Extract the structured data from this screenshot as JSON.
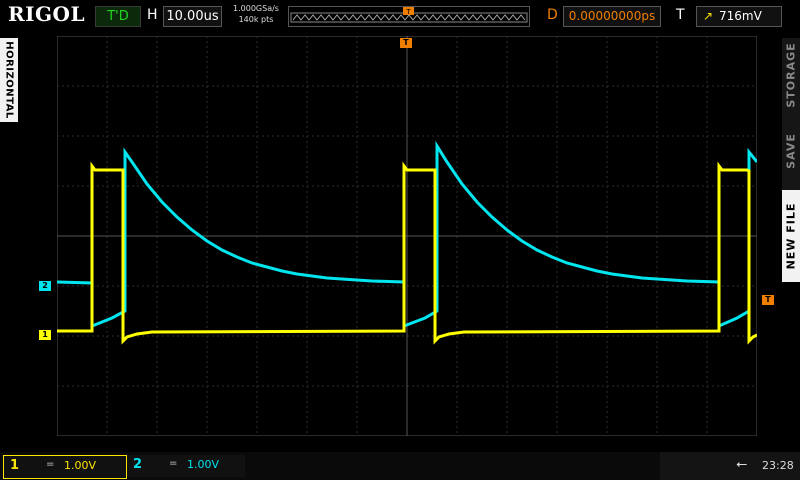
{
  "brand": "RIGOL",
  "run_status": "T'D",
  "horizontal": {
    "label": "H",
    "timebase": "10.00us"
  },
  "acquisition": {
    "sample_rate": "1.000GSa/s",
    "memory_depth": "140k pts"
  },
  "delay": {
    "label": "D",
    "value": "0.00000000ps"
  },
  "trigger": {
    "label": "T",
    "icon": "rising-edge-icon",
    "level": "716mV"
  },
  "left_menu": {
    "label": "HORIZONTAL"
  },
  "right_menu": {
    "items": [
      "STORAGE",
      "SAVE",
      "NEW FILE"
    ]
  },
  "channels": [
    {
      "number": "1",
      "coupling": "=",
      "scale": "1.00V",
      "color": "#ffff00"
    },
    {
      "number": "2",
      "coupling": "=",
      "scale": "1.00V",
      "color": "#00e5ee"
    }
  ],
  "markers": {
    "ch1": "1",
    "ch2": "2",
    "trigger": "T"
  },
  "status": {
    "time": "23:28",
    "usb_icon": "usb-icon"
  },
  "colors": {
    "trigger": "#f07f00",
    "grid": "#3a3a3a"
  }
}
